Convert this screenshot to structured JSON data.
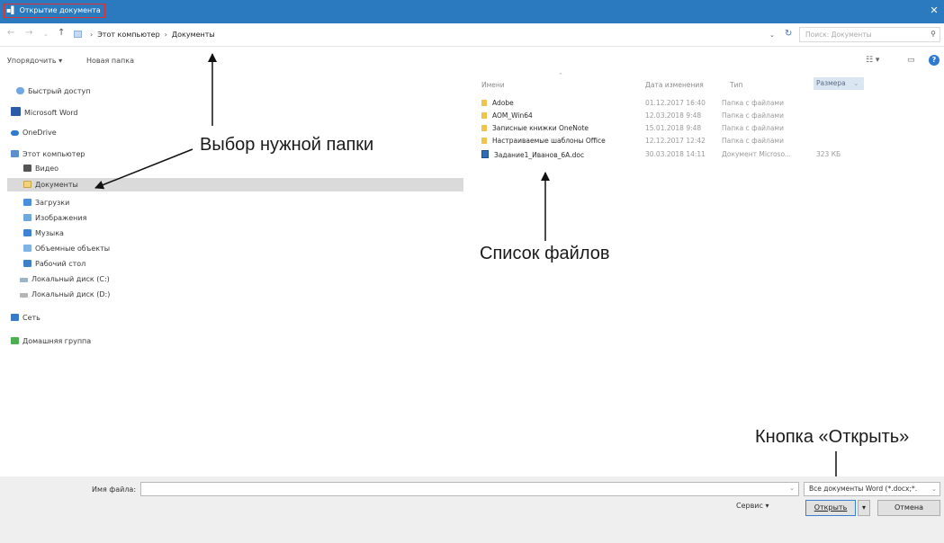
{
  "window": {
    "title": "Открытие документа"
  },
  "address_bar": {
    "path": [
      "Этот компьютер",
      "Документы"
    ],
    "search_placeholder": "Поиск: Документы"
  },
  "toolbar": {
    "organize": "Упорядочить ▾",
    "new_folder": "Новая папка"
  },
  "nav_pane": {
    "items": [
      {
        "label": "Быстрый доступ",
        "icon": "star-icon"
      },
      {
        "label": "Microsoft Word",
        "icon": "word-icon"
      },
      {
        "label": "OneDrive",
        "icon": "cloud-icon"
      },
      {
        "label": "Этот компьютер",
        "icon": "computer-icon"
      },
      {
        "label": "Видео",
        "icon": "video-folder-icon"
      },
      {
        "label": "Документы",
        "icon": "documents-folder-icon",
        "selected": true
      },
      {
        "label": "Загрузки",
        "icon": "downloads-folder-icon"
      },
      {
        "label": "Изображения",
        "icon": "pictures-folder-icon"
      },
      {
        "label": "Музыка",
        "icon": "music-folder-icon"
      },
      {
        "label": "Объемные объекты",
        "icon": "3d-objects-icon"
      },
      {
        "label": "Рабочий стол",
        "icon": "desktop-folder-icon"
      },
      {
        "label": "Локальный диск (C:)",
        "icon": "drive-icon"
      },
      {
        "label": "Локальный диск (D:)",
        "icon": "drive-icon"
      },
      {
        "label": "Сеть",
        "icon": "network-icon"
      },
      {
        "label": "Домашняя группа",
        "icon": "homegroup-icon"
      }
    ]
  },
  "file_list": {
    "columns": {
      "name": "Имени",
      "date": "Дата изменения",
      "type": "Тип",
      "size": "Размера"
    },
    "rows": [
      {
        "name": "Adobe",
        "date": "01.12.2017 16:40",
        "type": "Папка с файлами",
        "size": ""
      },
      {
        "name": "AOM_Win64",
        "date": "12.03.2018 9:48",
        "type": "Папка с файлами",
        "size": ""
      },
      {
        "name": "Записные книжки OneNote",
        "date": "15.01.2018 9:48",
        "type": "Папка с файлами",
        "size": ""
      },
      {
        "name": "Настраиваемые шаблоны Office",
        "date": "12.12.2017 12:42",
        "type": "Папка с файлами",
        "size": ""
      },
      {
        "name": "Задание1_Иванов_6А.doc",
        "date": "30.03.2018 14:11",
        "type": "Документ Microso...",
        "size": "323 КБ"
      }
    ]
  },
  "annotations": {
    "folder_choice": "Выбор нужной папки",
    "file_list": "Список файлов",
    "open_button": "Кнопка «Открыть»"
  },
  "bottom": {
    "filename_label": "Имя файла:",
    "filename_value": "",
    "filter": "Все документы Word (*.docx;*.",
    "service": "Сервис ▾",
    "open": "Открыть",
    "cancel": "Отмена"
  },
  "colors": {
    "titlebar": "#2b7ac0",
    "selection": "#dadada",
    "folder": "#f0c44c",
    "title_highlight": "#e23030"
  }
}
